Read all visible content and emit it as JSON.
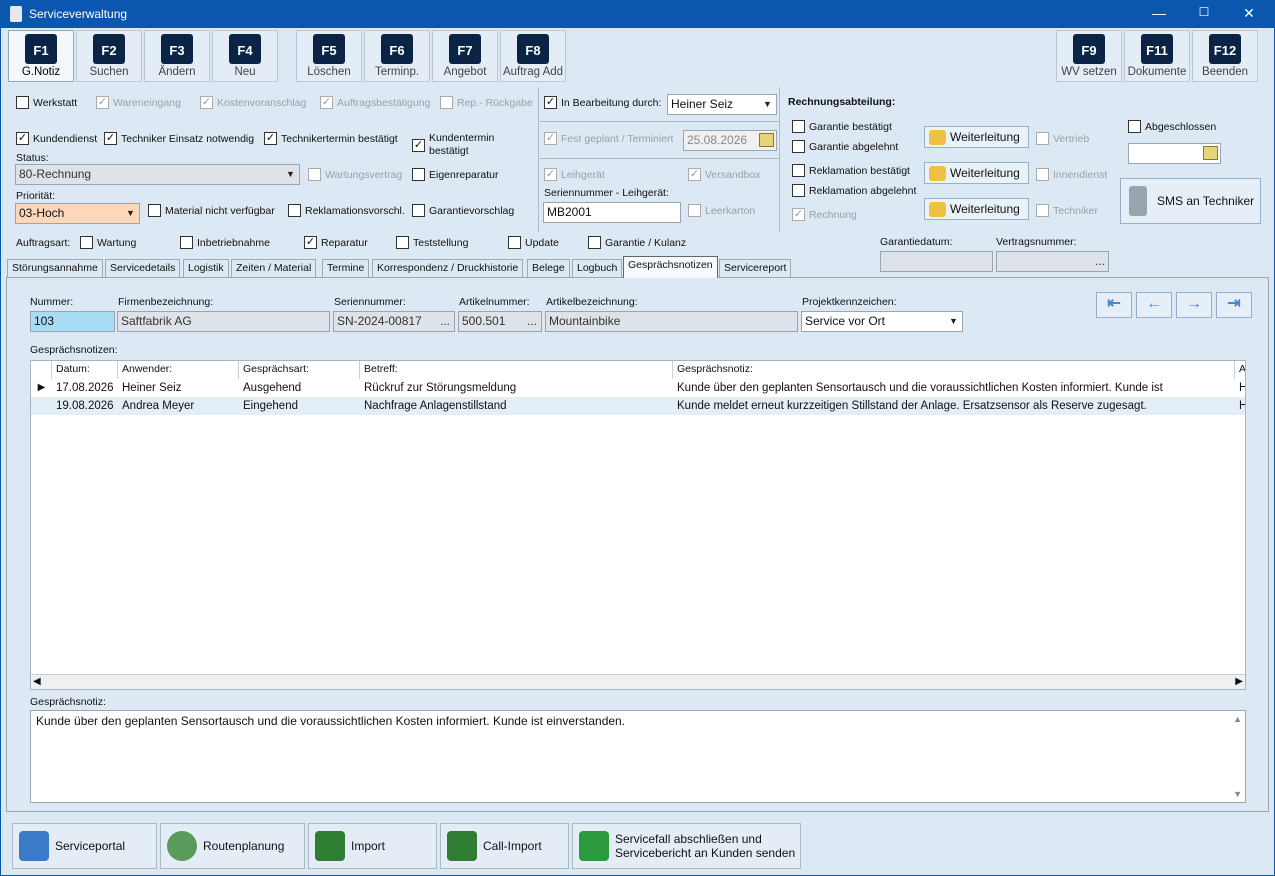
{
  "window": {
    "title": "Serviceverwaltung"
  },
  "fkeys": [
    {
      "key": "F1",
      "label": "G.Notiz"
    },
    {
      "key": "F2",
      "label": "Suchen"
    },
    {
      "key": "F3",
      "label": "Ändern"
    },
    {
      "key": "F4",
      "label": "Neu"
    },
    {
      "key": "F5",
      "label": "Löschen"
    },
    {
      "key": "F6",
      "label": "Terminp."
    },
    {
      "key": "F7",
      "label": "Angebot"
    },
    {
      "key": "F8",
      "label": "Auftrag Add"
    },
    {
      "key": "F9",
      "label": "WV setzen"
    },
    {
      "key": "F11",
      "label": "Dokumente"
    },
    {
      "key": "F12",
      "label": "Beenden"
    }
  ],
  "flags": {
    "werkstatt": "Werkstatt",
    "wareneingang": "Wareneingang",
    "kostenvoranschlag": "Kostenvoranschlag",
    "auftragsbestaetigung": "Auftragsbestätigung",
    "rep_rueckgabe": "Rep.- Rückgabe",
    "kundendienst": "Kundendienst",
    "techniker_einsatz": "Techniker Einsatz notwendig",
    "technikertermin": "Technikertermin bestätigt",
    "kundentermin": "Kundentermin bestätigt",
    "wartungsvertrag": "Wartungsvertrag",
    "eigenreparatur": "Eigenreparatur",
    "material": "Material nicht verfügbar",
    "reklamationsvorschl": "Reklamationsvorschl.",
    "garantievorschlag": "Garantievorschlag"
  },
  "status": {
    "label": "Status:",
    "value": "80-Rechnung"
  },
  "prioritaet": {
    "label": "Priorität:",
    "value": "03-Hoch"
  },
  "bearbeitung": {
    "label": "In Bearbeitung durch:",
    "value": "Heiner Seiz",
    "fest_label": "Fest geplant / Terminiert",
    "date": "25.08.2026",
    "leihgeraet": "Leihgerät",
    "versandbox": "Versandbox",
    "sn_label": "Seriennummer - Leihgerät:",
    "sn_value": "MB2001",
    "leerkarton": "Leerkarton",
    "rechnung": "Rechnung"
  },
  "rechnung": {
    "title": "Rechnungsabteilung:",
    "garantie_best": "Garantie bestätigt",
    "garantie_abg": "Garantie abgelehnt",
    "reklam_best": "Reklamation bestätigt",
    "reklam_abg": "Reklamation abgelehnt",
    "weiterleitung": "Weiterleitung",
    "vertrieb": "Vertrieb",
    "innendienst": "Innendienst",
    "techniker": "Techniker",
    "abgeschlossen": "Abgeschlossen",
    "sms": "SMS an Techniker"
  },
  "auftragsart": {
    "label": "Auftragsart:",
    "wartung": "Wartung",
    "inbetriebnahme": "Inbetriebnahme",
    "reparatur": "Reparatur",
    "teststellung": "Teststellung",
    "update": "Update",
    "garantie": "Garantie / Kulanz",
    "garantiedatum": "Garantiedatum:",
    "vertragsnummer": "Vertragsnummer:",
    "vertrag_btn": "..."
  },
  "tabs": [
    "Störungsannahme",
    "Servicedetails",
    "Logistik",
    "Zeiten / Material",
    "Termine",
    "Korrespondenz / Druckhistorie",
    "Belege",
    "Logbuch",
    "Gesprächsnotizen",
    "Servicereport"
  ],
  "form": {
    "nummer_label": "Nummer:",
    "nummer": "103",
    "firma_label": "Firmenbezeichnung:",
    "firma": "Saftfabrik AG",
    "sn_label": "Seriennummer:",
    "sn": "SN-2024-00817",
    "art_label": "Artikelnummer:",
    "art": "500.501",
    "artbez_label": "Artikelbezeichnung:",
    "artbez": "Mountainbike",
    "projekt_label": "Projektkennzeichen:",
    "projekt": "Service vor Ort",
    "ellipsis": "..."
  },
  "notes": {
    "label": "Gesprächsnotizen:",
    "columns": [
      "Datum:",
      "Anwender:",
      "Gesprächsart:",
      "Betreff:",
      "Gesprächsnotiz:",
      "A"
    ],
    "rows": [
      {
        "datum": "17.08.2026",
        "anwender": "Heiner Seiz",
        "art": "Ausgehend",
        "betreff": "Rückruf zur Störungsmeldung",
        "notiz": "Kunde über den geplanten Sensortausch und die voraussichtlichen Kosten informiert. Kunde ist",
        "a": "H"
      },
      {
        "datum": "19.08.2026",
        "anwender": "Andrea Meyer",
        "art": "Eingehend",
        "betreff": "Nachfrage Anlagenstillstand",
        "notiz": "Kunde meldet erneut kurzzeitigen Stillstand der Anlage. Ersatzsensor als Reserve zugesagt.",
        "a": "H"
      }
    ]
  },
  "detail": {
    "label": "Gesprächsnotiz:",
    "text": "Kunde über den geplanten Sensortausch und die voraussichtlichen Kosten informiert. Kunde ist einverstanden."
  },
  "bottom": {
    "serviceportal": "Serviceportal",
    "routenplanung": "Routenplanung",
    "import": "Import",
    "callimport": "Call-Import",
    "abschliessen1": "Servicefall abschließen und",
    "abschliessen2": "Servicebericht an Kunden senden"
  }
}
